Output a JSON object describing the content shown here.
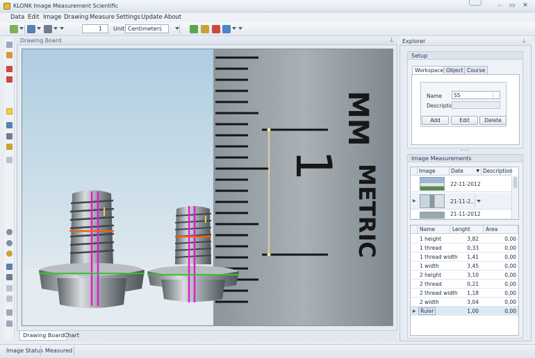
{
  "window": {
    "title": "KLONK Image Measurement Scientific"
  },
  "menu": [
    "Data",
    "Edit",
    "Image",
    "Drawing",
    "Measure",
    "Settings",
    "Update",
    "About"
  ],
  "toolbar": {
    "page_value": "1",
    "unit_label": "Unit",
    "unit_value": "Centimeters"
  },
  "drawing_board": {
    "title": "Drawing Board",
    "ruler_labels": {
      "mm": "MM",
      "one": "1",
      "metric": "METRIC"
    },
    "tabs": [
      "Drawing Board",
      "Chart"
    ]
  },
  "explorer": {
    "title": "Explorer",
    "setup": {
      "title": "Setup",
      "tabs": [
        "Workspace",
        "Object",
        "Course"
      ],
      "name_label": "Name",
      "name_value": "SS",
      "description_label": "Description",
      "buttons": {
        "add": "Add",
        "edit": "Edit",
        "delete": "Delete"
      }
    },
    "image_measurements": {
      "title": "Image Measurements",
      "image_columns": [
        "Image",
        "Date",
        "Description"
      ],
      "images": [
        {
          "date": "22-11-2012"
        },
        {
          "date": "21-11-2..."
        },
        {
          "date": "21-11-2012"
        }
      ],
      "measure_columns": [
        "Name",
        "Lenght",
        "Area"
      ],
      "measurements": [
        {
          "name": "1 height",
          "length": "3,82",
          "area": "0,00"
        },
        {
          "name": "1 thread",
          "length": "0,33",
          "area": "0,00"
        },
        {
          "name": "1 thread width",
          "length": "1,41",
          "area": "0,00"
        },
        {
          "name": "1 width",
          "length": "3,45",
          "area": "0,00"
        },
        {
          "name": "2 height",
          "length": "3,10",
          "area": "0,00"
        },
        {
          "name": "2 thread",
          "length": "0,21",
          "area": "0,00"
        },
        {
          "name": "2 thread width",
          "length": "1,18",
          "area": "0,00"
        },
        {
          "name": "2 width",
          "length": "3,04",
          "area": "0,00"
        },
        {
          "name": "Ruler",
          "length": "1,00",
          "area": "0,00"
        }
      ]
    }
  },
  "status": {
    "image_status": "Image Status",
    "measured": "Measured"
  },
  "colors": {
    "accent": "#e7b93a",
    "height_line": "#e01cd0",
    "thread_line": "#e8641a",
    "width_line": "#37c22c",
    "ruler_mark": "#f2e4a0"
  }
}
